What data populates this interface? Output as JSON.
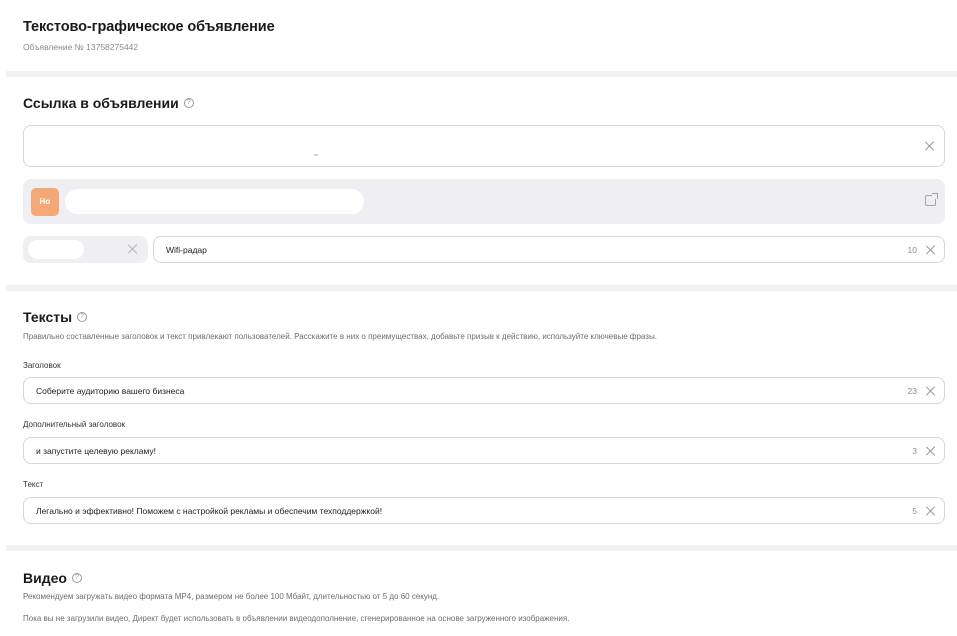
{
  "header": {
    "title": "Текстово-графическое объявление",
    "ad_number": "Объявление № 13758275442"
  },
  "link_section": {
    "title": "Ссылка в объявлении",
    "help_icon": "question-circle-icon",
    "url_value": "",
    "preview_avatar": "Но",
    "open_icon": "external-link-icon",
    "display_link_value": "Wifi-радар",
    "display_link_count": "10"
  },
  "texts_section": {
    "title": "Тексты",
    "description": "Правильно составленные заголовок и текст привлекают пользователей. Расскажите в них о преимуществах, добавьте призыв к действию, используйте ключевые фразы.",
    "headline_label": "Заголовок",
    "headline_value": "Соберите аудиторию вашего бизнеса",
    "headline_count": "23",
    "extra_headline_label": "Дополнительный заголовок",
    "extra_headline_value": "и запустите целевую рекламу!",
    "extra_headline_count": "3",
    "text_label": "Текст",
    "text_value": "Легально и эффективно! Поможем с настройкой рекламы и обеспечим техподдержкой!",
    "text_count": "5"
  },
  "video_section": {
    "title": "Видео",
    "description1": "Рекомендуем загружать видео формата MP4, размером не более 100 Мбайт, длительностью от 5 до 60 секунд.",
    "description2": "Пока вы не загрузили видео, Директ будет использовать в объявлении видеодополнение, сгенерированное на основе загруженного изображения."
  },
  "colors": {
    "avatar_bg": "#f5a877",
    "block_bg": "#efeff3",
    "divider": "#f2f2f2"
  }
}
